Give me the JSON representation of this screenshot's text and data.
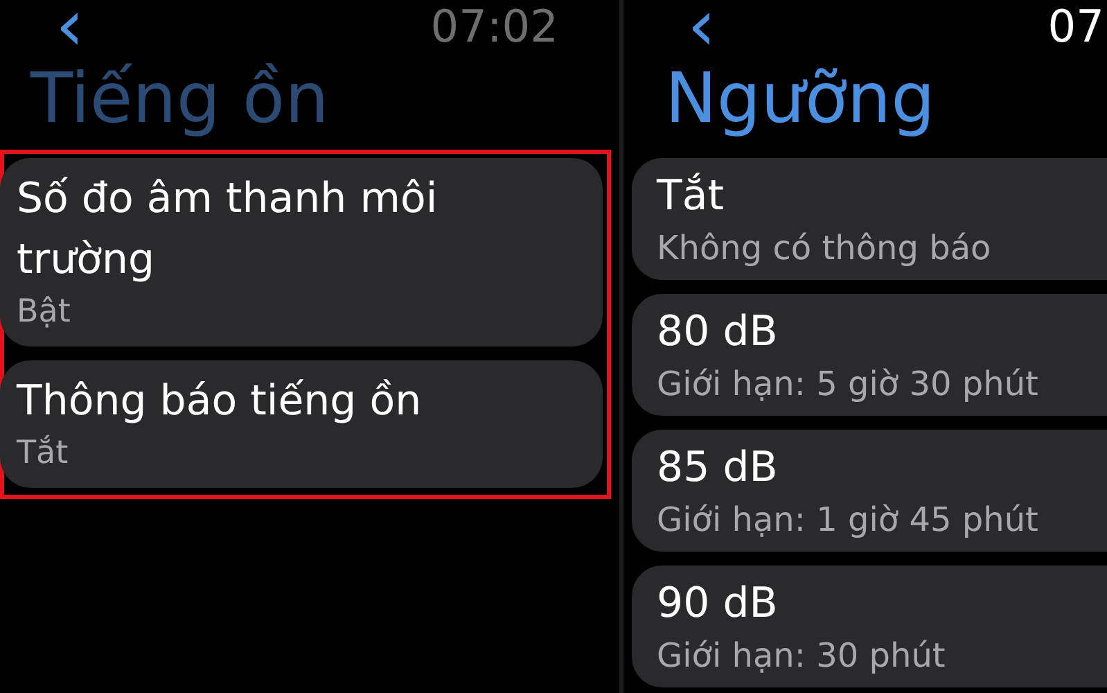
{
  "screens": [
    {
      "back": "‹",
      "time": "07:02",
      "title": "Tiếng ồn",
      "dimmed": true,
      "highlighted": true,
      "items": [
        {
          "label": "Số đo âm thanh môi trường",
          "value": "Bật"
        },
        {
          "label": "Thông báo tiếng ồn",
          "value": "Tắt"
        }
      ]
    },
    {
      "back": "‹",
      "time": "07",
      "title": "Ngưỡng",
      "dimmed": false,
      "items": [
        {
          "label": "Tắt",
          "value": "Không có thông báo"
        },
        {
          "label": "80 dB",
          "value": "Giới hạn: 5 giờ 30 phút"
        },
        {
          "label": "85 dB",
          "value": "Giới hạn: 1 giờ 45 phút"
        },
        {
          "label": "90 dB",
          "value": "Giới hạn: 30 phút"
        }
      ]
    }
  ]
}
